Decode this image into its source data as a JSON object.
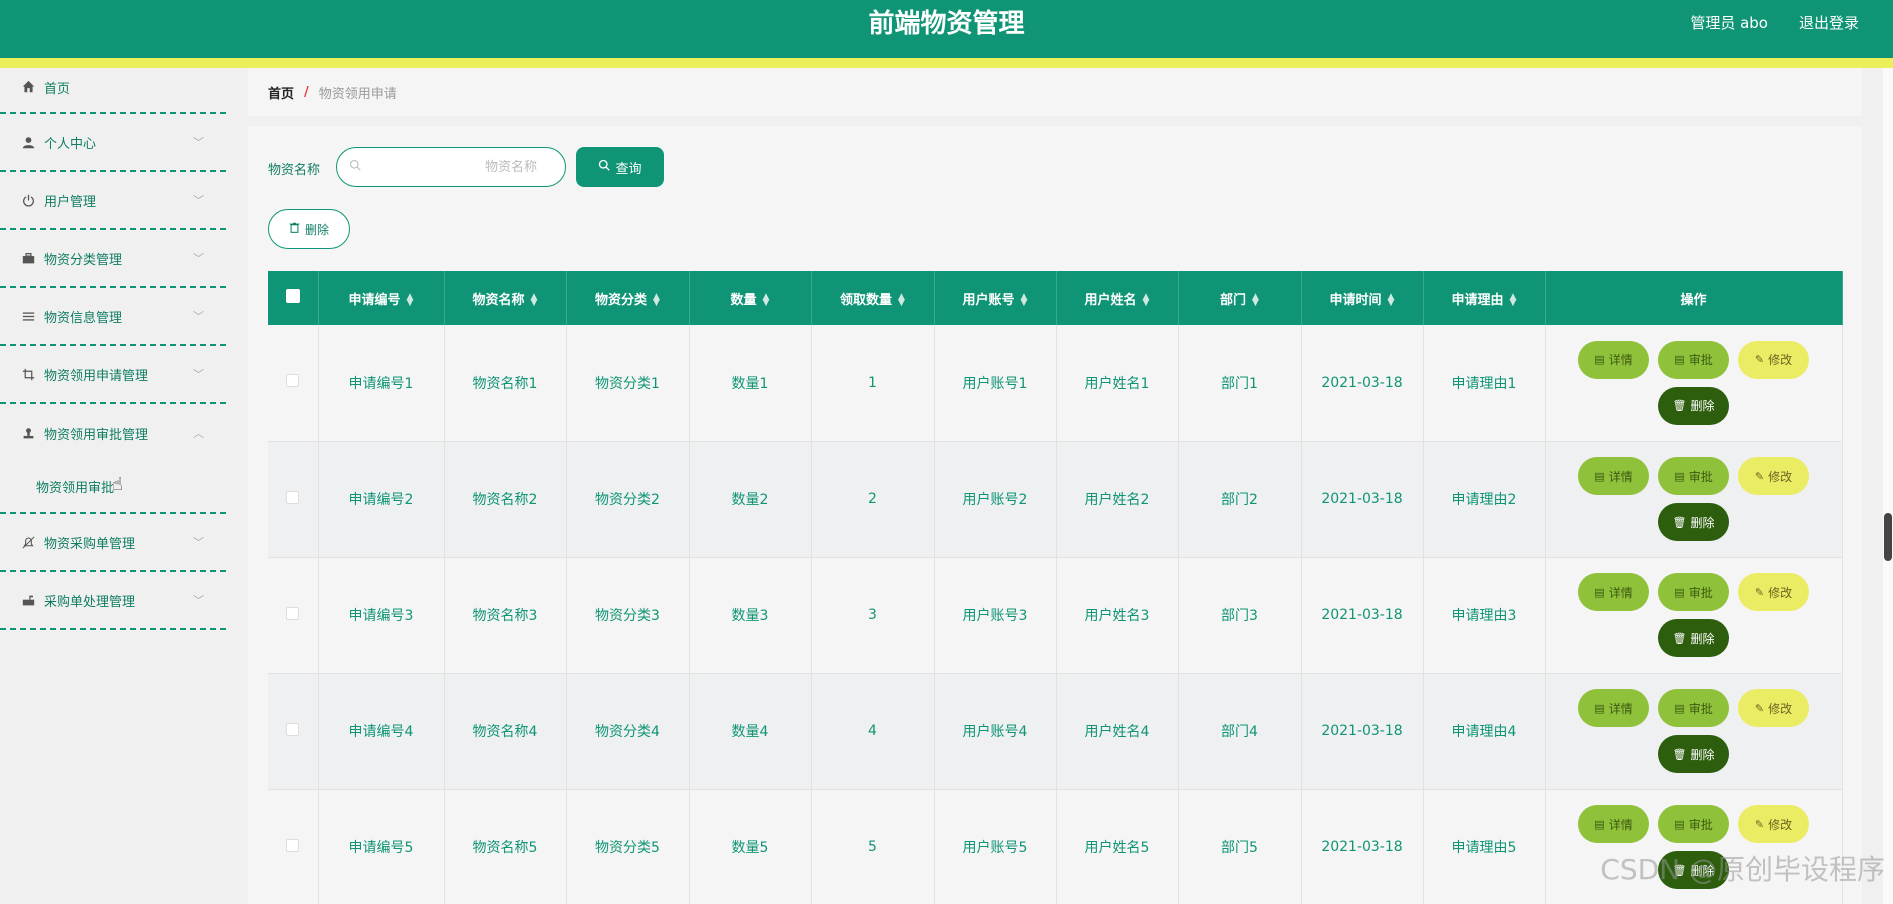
{
  "header": {
    "title": "前端物资管理",
    "admin": "管理员 abo",
    "logout": "退出登录"
  },
  "sidebar": {
    "items": [
      {
        "label": "首页",
        "icon": "home-icon"
      },
      {
        "label": "个人中心",
        "icon": "user-icon"
      },
      {
        "label": "用户管理",
        "icon": "power-icon"
      },
      {
        "label": "物资分类管理",
        "icon": "briefcase-icon"
      },
      {
        "label": "物资信息管理",
        "icon": "list-icon"
      },
      {
        "label": "物资领用申请管理",
        "icon": "crop-icon"
      },
      {
        "label": "物资领用审批管理",
        "icon": "stamp-icon"
      },
      {
        "label": "物资采购单管理",
        "icon": "bell-off-icon"
      },
      {
        "label": "采购单处理管理",
        "icon": "mailbox-icon"
      }
    ],
    "submenu": {
      "label": "物资领用审批"
    }
  },
  "breadcrumb": {
    "home": "首页",
    "separator": "/",
    "current": "物资领用申请"
  },
  "search": {
    "label": "物资名称",
    "placeholder": "物资名称",
    "value": "",
    "button": "查询"
  },
  "toolbar": {
    "delete": "删除"
  },
  "table": {
    "headers": [
      "申请编号",
      "物资名称",
      "物资分类",
      "数量",
      "领取数量",
      "用户账号",
      "用户姓名",
      "部门",
      "申请时间",
      "申请理由",
      "操作"
    ],
    "rows": [
      [
        "申请编号1",
        "物资名称1",
        "物资分类1",
        "数量1",
        "1",
        "用户账号1",
        "用户姓名1",
        "部门1",
        "2021-03-18",
        "申请理由1"
      ],
      [
        "申请编号2",
        "物资名称2",
        "物资分类2",
        "数量2",
        "2",
        "用户账号2",
        "用户姓名2",
        "部门2",
        "2021-03-18",
        "申请理由2"
      ],
      [
        "申请编号3",
        "物资名称3",
        "物资分类3",
        "数量3",
        "3",
        "用户账号3",
        "用户姓名3",
        "部门3",
        "2021-03-18",
        "申请理由3"
      ],
      [
        "申请编号4",
        "物资名称4",
        "物资分类4",
        "数量4",
        "4",
        "用户账号4",
        "用户姓名4",
        "部门4",
        "2021-03-18",
        "申请理由4"
      ],
      [
        "申请编号5",
        "物资名称5",
        "物资分类5",
        "数量5",
        "5",
        "用户账号5",
        "用户姓名5",
        "部门5",
        "2021-03-18",
        "申请理由5"
      ]
    ],
    "actions": {
      "detail": "详情",
      "approve": "审批",
      "edit": "修改",
      "delete": "删除"
    }
  },
  "watermark": "CSDN @原创毕设程序",
  "colors": {
    "primary": "#0f9575",
    "accent_bar": "#eaef5a",
    "detail_btn": "#8fc13b",
    "edit_btn": "#eaec64",
    "delete_btn": "#2d5e0d"
  }
}
